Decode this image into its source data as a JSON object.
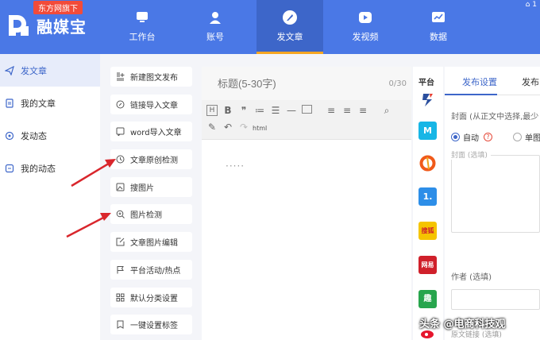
{
  "brand": {
    "tag": "东方网旗下",
    "name": "融媒宝"
  },
  "corner_info": "1",
  "nav": [
    {
      "label": "工作台",
      "icon": "monitor-icon"
    },
    {
      "label": "账号",
      "icon": "user-icon"
    },
    {
      "label": "发文章",
      "icon": "pen-icon",
      "active": true
    },
    {
      "label": "发视频",
      "icon": "video-icon"
    },
    {
      "label": "数据",
      "icon": "chart-icon"
    }
  ],
  "sidebar": [
    {
      "label": "发文章",
      "icon": "send-icon",
      "active": true
    },
    {
      "label": "我的文章",
      "icon": "document-icon"
    },
    {
      "label": "发动态",
      "icon": "circle-dot-icon"
    },
    {
      "label": "我的动态",
      "icon": "square-icon"
    }
  ],
  "tools": [
    {
      "label": "新建图文发布",
      "icon": "new-post-icon"
    },
    {
      "label": "链接导入文章",
      "icon": "link-icon"
    },
    {
      "label": "word导入文章",
      "icon": "word-import-icon"
    },
    {
      "label": "文章原创检测",
      "icon": "original-check-icon"
    },
    {
      "label": "搜图片",
      "icon": "image-search-icon"
    },
    {
      "label": "图片检测",
      "icon": "image-check-icon"
    },
    {
      "label": "文章图片编辑",
      "icon": "image-edit-icon"
    },
    {
      "label": "平台活动/热点",
      "icon": "flag-icon"
    },
    {
      "label": "默认分类设置",
      "icon": "grid-icon"
    },
    {
      "label": "一键设置标签",
      "icon": "tag-icon"
    }
  ],
  "editor": {
    "title_placeholder": "标题(5-30字)",
    "title_count": "0/30",
    "html_label": "html",
    "body_dots": "·····"
  },
  "platform": {
    "header": "平台",
    "logos": [
      {
        "icon": "platform-a-icon",
        "color": "#e8e8e8",
        "text": ""
      },
      {
        "icon": "platform-m-icon",
        "color": "#17b6e6",
        "text": "M"
      },
      {
        "icon": "platform-d-icon",
        "color": "#ffffff",
        "text": ""
      },
      {
        "icon": "platform-1-icon",
        "color": "#2d8ee8",
        "text": "1."
      },
      {
        "icon": "platform-sohu-icon",
        "color": "#f5c400",
        "text": "搜狐"
      },
      {
        "icon": "platform-wangyi-icon",
        "color": "#d0202b",
        "text": "网易"
      },
      {
        "icon": "platform-qu-icon",
        "color": "#27a54d",
        "text": "趣"
      },
      {
        "icon": "platform-weibo-icon",
        "color": "#ffffff",
        "text": ""
      }
    ]
  },
  "settings": {
    "tab_active": "发布设置",
    "tab_other": "发布",
    "cover_label": "封面 (从正文中选择,最少",
    "radio_auto": "自动",
    "radio_single": "单图",
    "help": "?",
    "cover_box_label": "封面 (选填)",
    "author_label": "作者 (选填)",
    "source_label": "原文链接 (选填)"
  },
  "watermark": "头条 @电商科技观",
  "colors": {
    "header": "#4a78e6",
    "accent": "#3d66c9",
    "active_underline": "#f5a623",
    "arrow": "#d9262c",
    "brand_tag": "#f24b3a"
  }
}
